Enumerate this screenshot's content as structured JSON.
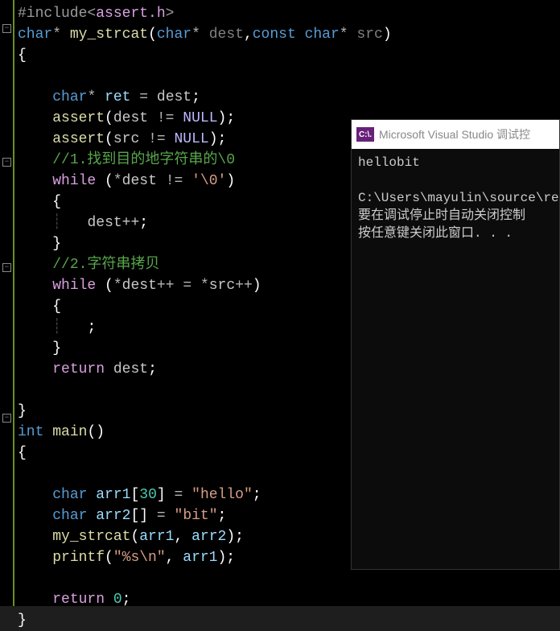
{
  "code": {
    "include_directive": "#include",
    "include_header": "assert.h",
    "func1_ret": "char",
    "func1_name": "my_strcat",
    "func1_param1_type": "char",
    "func1_param1_name": "dest",
    "func1_param2_mod": "const",
    "func1_param2_type": "char",
    "func1_param2_name": "src",
    "brace_open": "{",
    "brace_close": "}",
    "line_ret_decl_type": "char",
    "line_ret_decl_name": "ret",
    "line_ret_decl_val": "dest",
    "assert_call": "assert",
    "assert1_expr_l": "dest",
    "assert1_expr_op": "!=",
    "assert_null": "NULL",
    "assert2_expr_l": "src",
    "comment1": "//1.找到目的地字符串的\\0",
    "while_kw": "while",
    "while1_lhs": "*dest",
    "while1_op": "!=",
    "while1_rhs": "'\\0'",
    "while1_body": "dest++",
    "comment2": "//2.字符串拷贝",
    "while2_lhs": "*dest++",
    "while2_op": "=",
    "while2_rhs": "*src++",
    "return_kw": "return",
    "return1_val": "dest",
    "empty_stmt": ";",
    "main_ret": "int",
    "main_name": "main",
    "arr1_type": "char",
    "arr1_name": "arr1",
    "arr1_size": "30",
    "arr1_val": "\"hello\"",
    "arr2_type": "char",
    "arr2_name": "arr2",
    "arr2_val": "\"bit\"",
    "call_strcat": "my_strcat",
    "call_arg1": "arr1",
    "call_arg2": "arr2",
    "printf_name": "printf",
    "printf_fmt": "\"%s\\n\"",
    "printf_arg": "arr1",
    "return2_val": "0"
  },
  "console": {
    "icon_text": "C:\\.",
    "title": "Microsoft Visual Studio 调试控",
    "output_line": "hellobit",
    "path_line": "C:\\Users\\mayulin\\source\\re",
    "hint_line1": "要在调试停止时自动关闭控制",
    "hint_line2": "按任意键关闭此窗口. . ."
  }
}
